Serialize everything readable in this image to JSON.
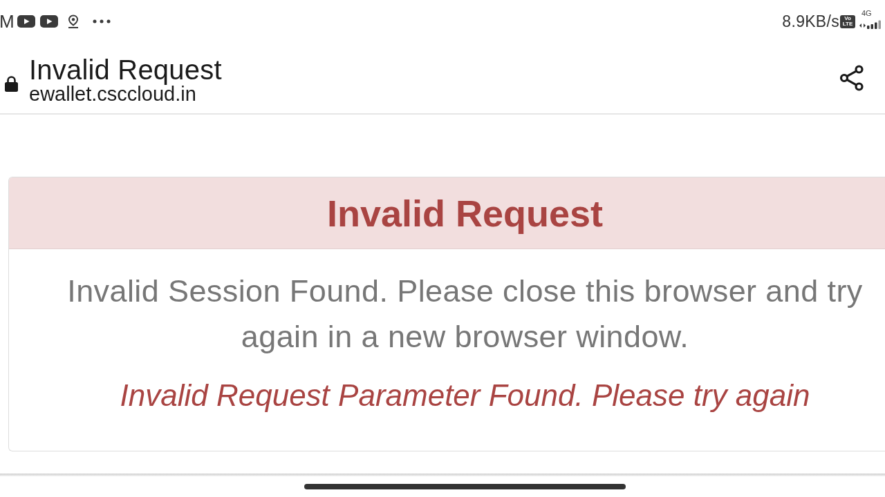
{
  "status_bar": {
    "left_text": "M",
    "notification_icons": [
      {
        "kind": "video"
      },
      {
        "kind": "video"
      },
      {
        "kind": "location"
      },
      {
        "kind": "more"
      }
    ],
    "network_speed": "8.9KB/s",
    "volte_badge": [
      "Vo",
      "LTE"
    ],
    "network_type": "4G"
  },
  "browser_bar": {
    "title": "Invalid Request",
    "url": "ewallet.csccloud.in",
    "secure": true
  },
  "alert": {
    "heading": "Invalid Request",
    "message": "Invalid Session Found. Please close this browser and try again in a new browser window.",
    "error": "Invalid Request Parameter Found. Please try again"
  }
}
